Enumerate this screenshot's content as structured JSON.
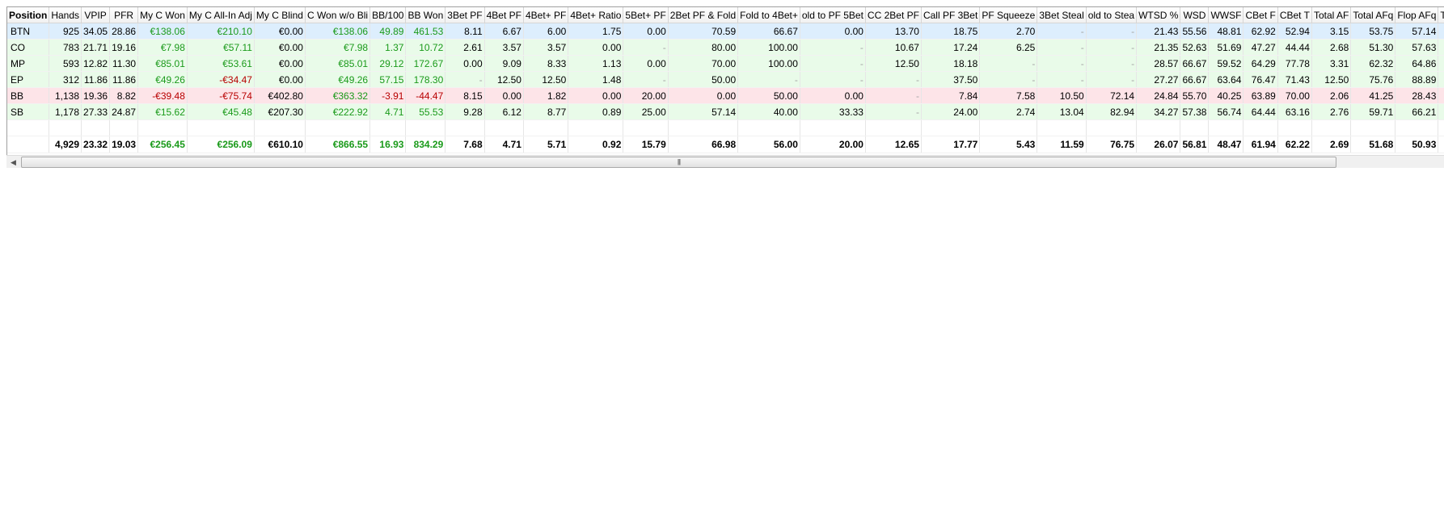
{
  "table": {
    "columns": [
      "Position",
      "Hands",
      "VPIP",
      "PFR",
      "My C Won",
      "My C All-In Adj",
      "My C Blind",
      "C Won w/o Bli",
      "BB/100",
      "BB Won",
      "3Bet PF",
      "4Bet PF",
      "4Bet+ PF",
      "4Bet+ Ratio",
      "5Bet+ PF",
      "2Bet PF & Fold",
      "Fold to 4Bet+",
      "old to PF 5Bet",
      "CC 2Bet PF",
      "Call PF 3Bet",
      "PF Squeeze",
      "3Bet Steal",
      "old to Stea",
      "WTSD %",
      "WSD",
      "WWSF",
      "CBet F",
      "CBet T",
      "Total AF",
      "Total AFq",
      "Flop AFq",
      "Tur"
    ],
    "rows": [
      {
        "style": "blue",
        "cells": [
          "BTN",
          "925",
          "34.05",
          "28.86",
          "€138.06",
          "€210.10",
          "€0.00",
          "€138.06",
          "49.89",
          "461.53",
          "8.11",
          "6.67",
          "6.00",
          "1.75",
          "0.00",
          "70.59",
          "66.67",
          "0.00",
          "13.70",
          "18.75",
          "2.70",
          "-",
          "-",
          "21.43",
          "55.56",
          "48.81",
          "62.92",
          "52.94",
          "3.15",
          "53.75",
          "57.14",
          ""
        ]
      },
      {
        "style": "green",
        "cells": [
          "CO",
          "783",
          "21.71",
          "19.16",
          "€7.98",
          "€57.11",
          "€0.00",
          "€7.98",
          "1.37",
          "10.72",
          "2.61",
          "3.57",
          "3.57",
          "0.00",
          "-",
          "80.00",
          "100.00",
          "-",
          "10.67",
          "17.24",
          "6.25",
          "-",
          "-",
          "21.35",
          "52.63",
          "51.69",
          "47.27",
          "44.44",
          "2.68",
          "51.30",
          "57.63",
          ""
        ]
      },
      {
        "style": "green",
        "cells": [
          "MP",
          "593",
          "12.82",
          "11.30",
          "€85.01",
          "€53.61",
          "€0.00",
          "€85.01",
          "29.12",
          "172.67",
          "0.00",
          "9.09",
          "8.33",
          "1.13",
          "0.00",
          "70.00",
          "100.00",
          "-",
          "12.50",
          "18.18",
          "-",
          "-",
          "-",
          "28.57",
          "66.67",
          "59.52",
          "64.29",
          "77.78",
          "3.31",
          "62.32",
          "64.86",
          ""
        ]
      },
      {
        "style": "green",
        "cells": [
          "EP",
          "312",
          "11.86",
          "11.86",
          "€49.26",
          "-€34.47",
          "€0.00",
          "€49.26",
          "57.15",
          "178.30",
          "-",
          "12.50",
          "12.50",
          "1.48",
          "-",
          "50.00",
          "-",
          "-",
          "-",
          "37.50",
          "-",
          "-",
          "-",
          "27.27",
          "66.67",
          "63.64",
          "76.47",
          "71.43",
          "12.50",
          "75.76",
          "88.89",
          ""
        ]
      },
      {
        "style": "red",
        "cells": [
          "BB",
          "1,138",
          "19.36",
          "8.82",
          "-€39.48",
          "-€75.74",
          "€402.80",
          "€363.32",
          "-3.91",
          "-44.47",
          "8.15",
          "0.00",
          "1.82",
          "0.00",
          "20.00",
          "0.00",
          "50.00",
          "0.00",
          "-",
          "7.84",
          "7.58",
          "10.50",
          "72.14",
          "24.84",
          "55.70",
          "40.25",
          "63.89",
          "70.00",
          "2.06",
          "41.25",
          "28.43",
          ""
        ]
      },
      {
        "style": "green",
        "cells": [
          "SB",
          "1,178",
          "27.33",
          "24.87",
          "€15.62",
          "€45.48",
          "€207.30",
          "€222.92",
          "4.71",
          "55.53",
          "9.28",
          "6.12",
          "8.77",
          "0.89",
          "25.00",
          "57.14",
          "40.00",
          "33.33",
          "-",
          "24.00",
          "2.74",
          "13.04",
          "82.94",
          "34.27",
          "57.38",
          "56.74",
          "64.44",
          "63.16",
          "2.76",
          "59.71",
          "66.21",
          ""
        ]
      }
    ],
    "totals": [
      "",
      "4,929",
      "23.32",
      "19.03",
      "€256.45",
      "€256.09",
      "€610.10",
      "€866.55",
      "16.93",
      "834.29",
      "7.68",
      "4.71",
      "5.71",
      "0.92",
      "15.79",
      "66.98",
      "56.00",
      "20.00",
      "12.65",
      "17.77",
      "5.43",
      "11.59",
      "76.75",
      "26.07",
      "56.81",
      "48.47",
      "61.94",
      "62.22",
      "2.69",
      "51.68",
      "50.93",
      ""
    ]
  },
  "colors": {
    "positive": "#1a9a1a",
    "negative": "#b80000",
    "row_blue": "#ddeefd",
    "row_green": "#e9fbe9",
    "row_red": "#fde4e8"
  },
  "scrollbar": {
    "left_arrow_icon": "chevron-left-icon",
    "thumb_grip_icon": "grip-lines-icon",
    "resize_grip_icon": "resize-dots-icon"
  }
}
